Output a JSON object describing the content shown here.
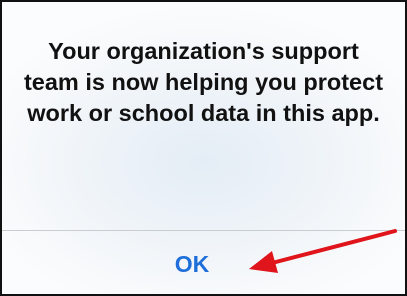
{
  "alert": {
    "message": "Your organization's support team is now helping you protect work or school data in this app.",
    "ok_label": "OK"
  },
  "colors": {
    "button_text": "#1e6fd9",
    "annotation_arrow": "#e0141b",
    "message_text": "#111111"
  },
  "icons": {
    "annotation": "red-arrow-icon"
  }
}
